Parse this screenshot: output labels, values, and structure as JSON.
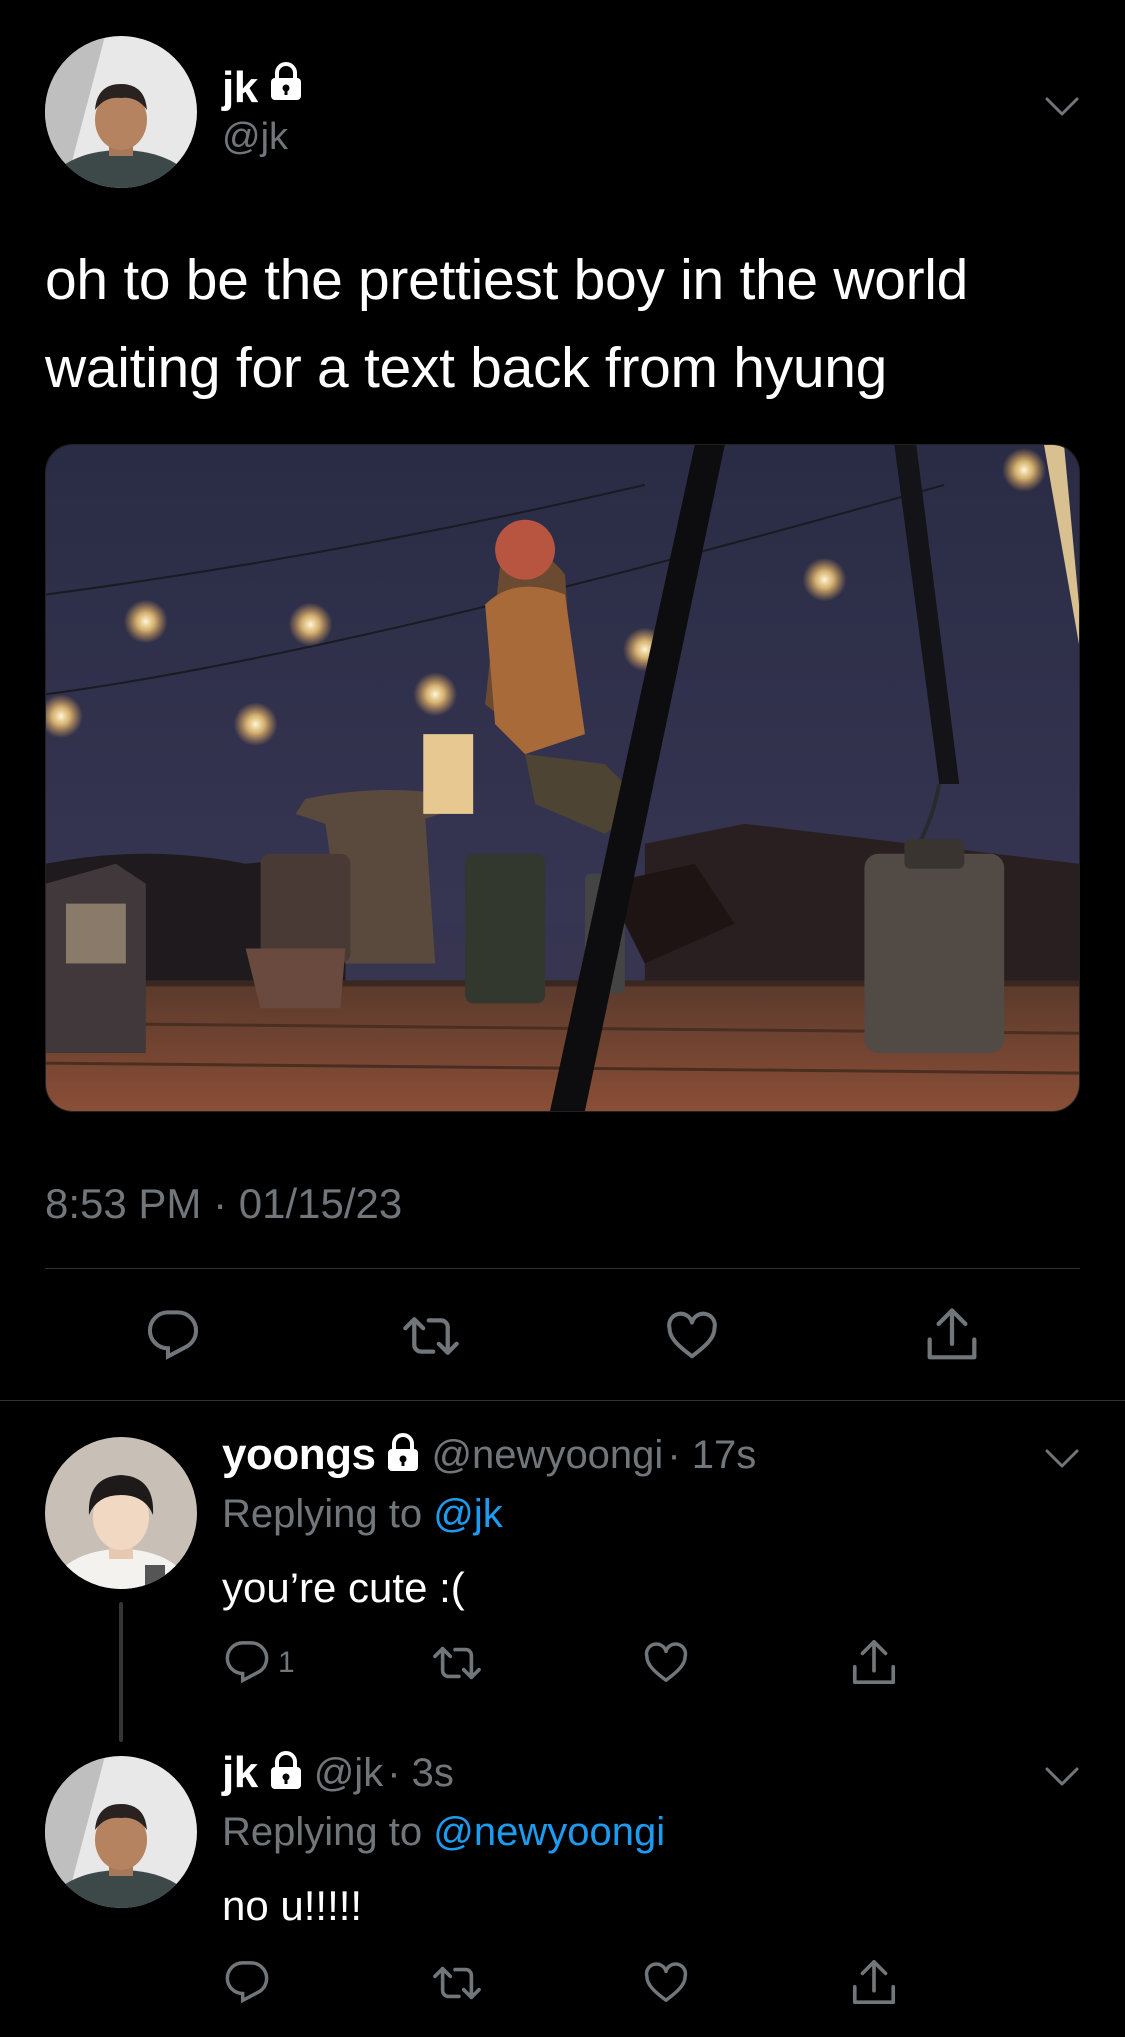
{
  "tweet": {
    "author_name": "jk",
    "author_handle": "@jk",
    "text_line1": "oh to be the prettiest boy in the world",
    "text_line2": "waiting for a text back from hyung",
    "timestamp": "8:53 PM · 01/15/23",
    "actions": {
      "reply_icon": "reply-icon",
      "retweet_icon": "retweet-icon",
      "like_icon": "like-icon",
      "share_icon": "share-icon"
    }
  },
  "replies": [
    {
      "author_name": "yoongs",
      "author_handle": "@newyoongi",
      "time": "· 17s",
      "replying_prefix": "Replying to ",
      "replying_to": "@jk",
      "text": "you’re cute :(",
      "reply_count": "1"
    },
    {
      "author_name": "jk",
      "author_handle": "@jk",
      "time": "· 3s",
      "replying_prefix": "Replying to ",
      "replying_to": "@newyoongi",
      "text": "no u!!!!!",
      "reply_count": ""
    }
  ],
  "colors": {
    "background": "#000000",
    "secondary_text": "#71767b",
    "link": "#1d9bf0",
    "divider": "#2f3336"
  }
}
